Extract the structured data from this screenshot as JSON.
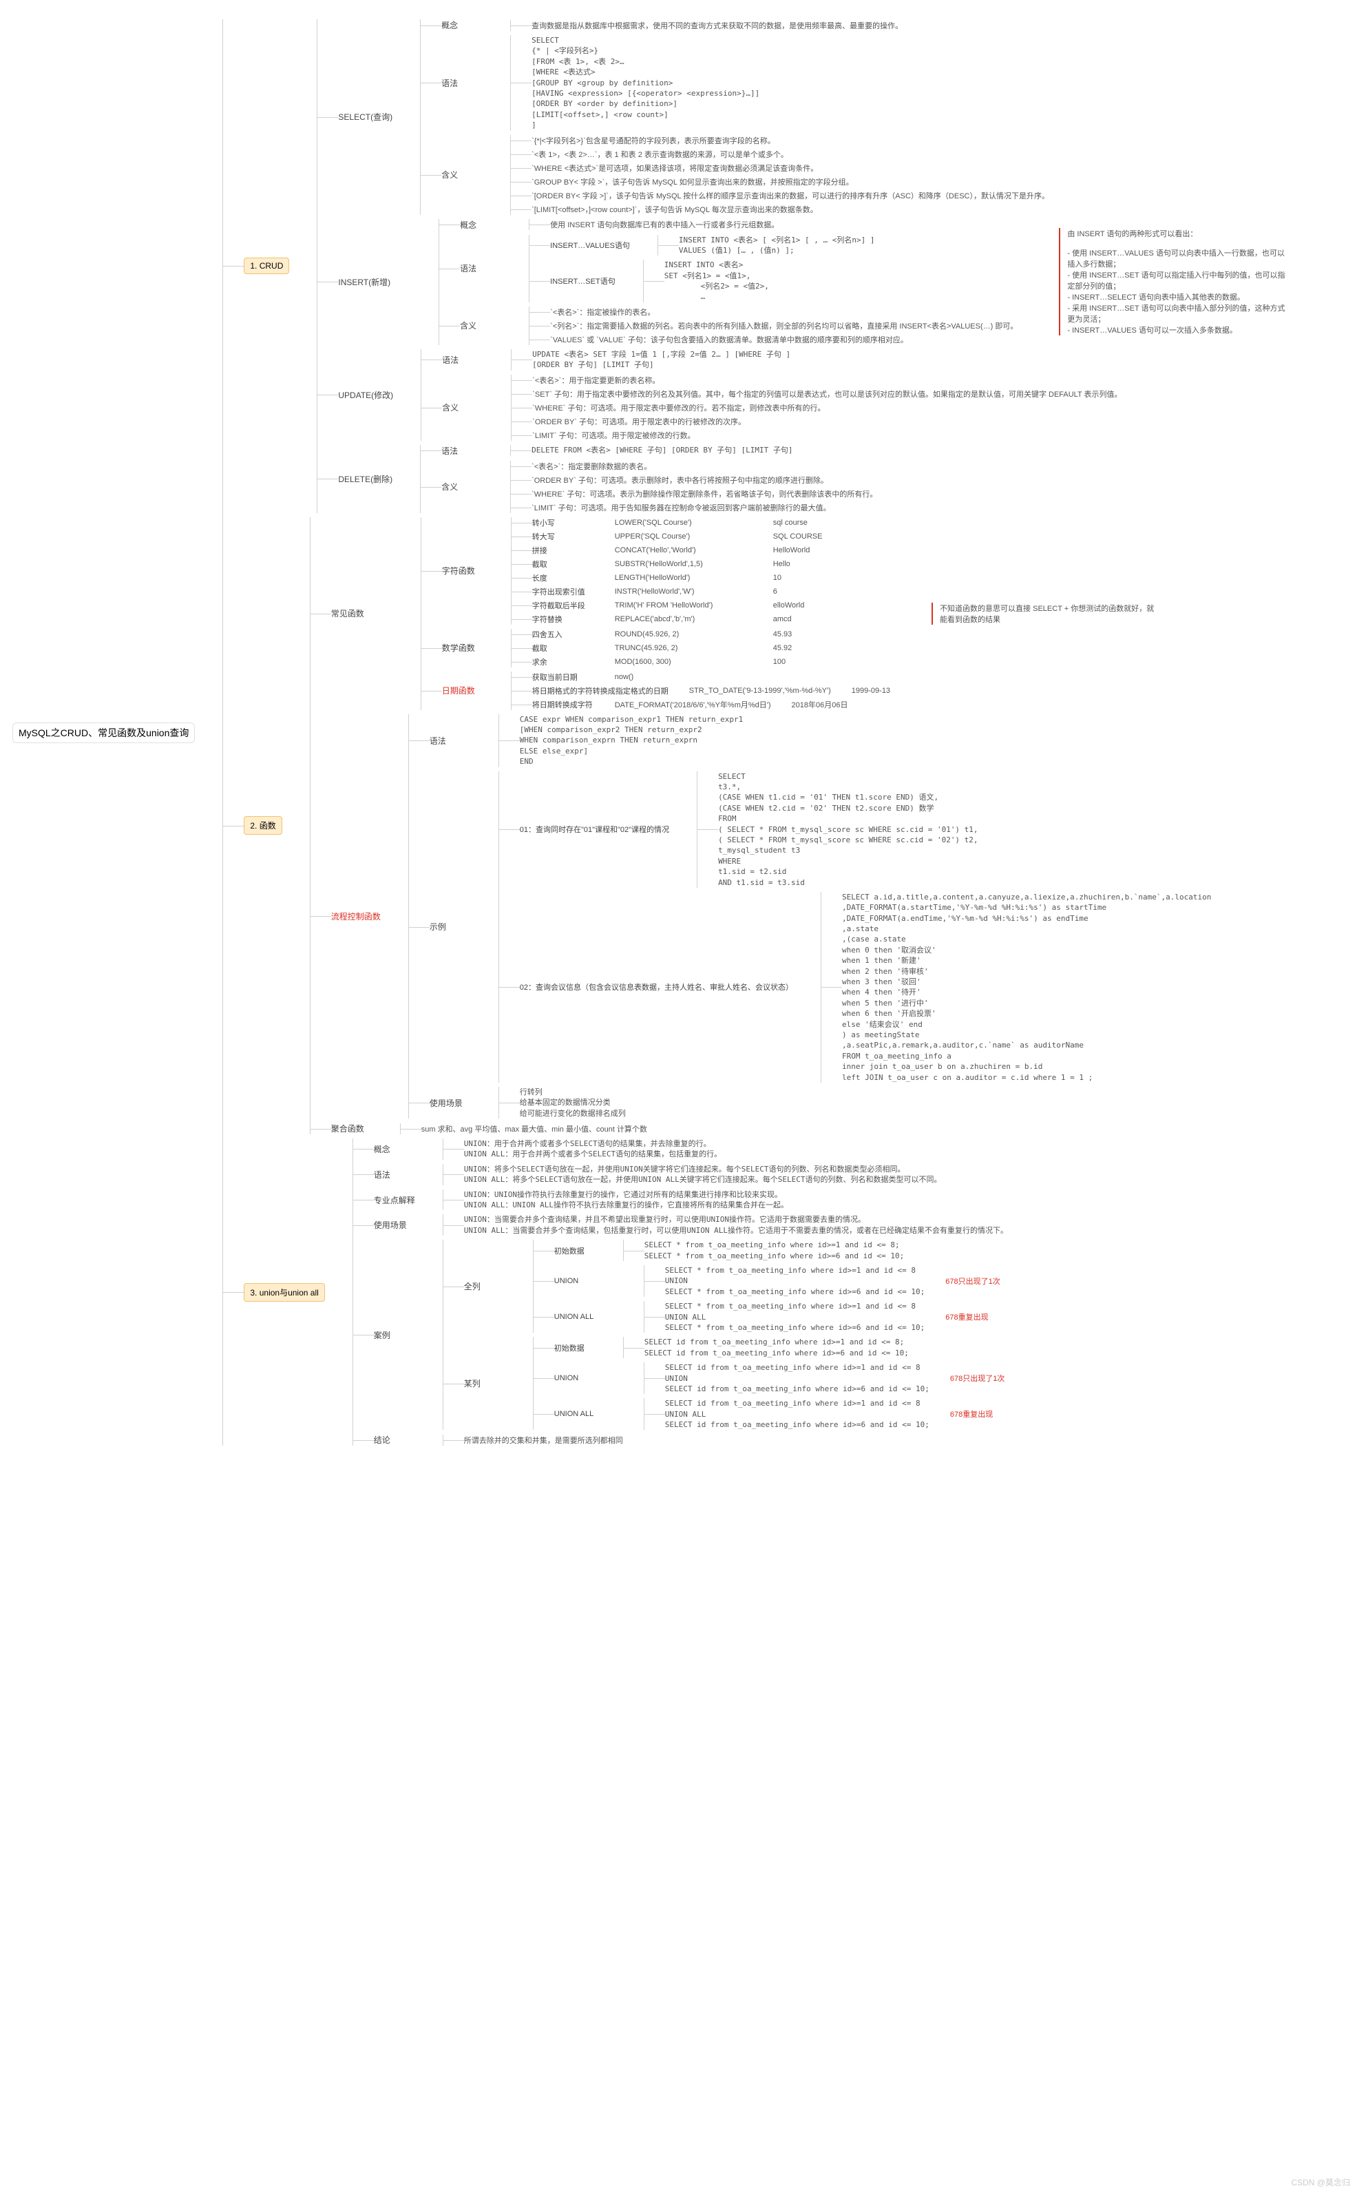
{
  "root": "MySQL之CRUD、常见函数及union查询",
  "watermark": "CSDN @莫念归",
  "l1": [
    "1. CRUD",
    "2. 函数",
    "3. union与union all"
  ],
  "crud": {
    "nodes": [
      "SELECT(查询)",
      "INSERT(新增)",
      "UPDATE(修改)",
      "DELETE(删除)"
    ],
    "select": {
      "concept_lbl": "概念",
      "concept": "查询数据是指从数据库中根据需求，使用不同的查询方式来获取不同的数据，是使用频率最高、最重要的操作。",
      "syntax_lbl": "语法",
      "syntax": "SELECT\n{* | <字段列名>}\n[FROM <表 1>, <表 2>…\n[WHERE <表达式>\n[GROUP BY <group by definition>\n[HAVING <expression> [{<operator> <expression>}…]]\n[ORDER BY <order by definition>]\n[LIMIT[<offset>,] <row count>]\n]",
      "meaning_lbl": "含义",
      "m1": "`{*|<字段列名>}`包含星号通配符的字段列表，表示所要查询字段的名称。",
      "m2": "`<表 1>，<表 2>…`，表 1 和表 2 表示查询数据的来源，可以是单个或多个。",
      "m3": "`WHERE <表达式>`是可选项，如果选择该项，将限定查询数据必须满足该查询条件。",
      "m4": "`GROUP BY< 字段 >`，该子句告诉 MySQL 如何显示查询出来的数据，并按照指定的字段分组。",
      "m5": "`[ORDER BY< 字段 >]`，该子句告诉 MySQL 按什么样的顺序显示查询出来的数据，可以进行的排序有升序（ASC）和降序（DESC），默认情况下是升序。",
      "m6": "`[LIMIT[<offset>，]<row count>]`，该子句告诉 MySQL 每次显示查询出来的数据条数。"
    },
    "insert": {
      "concept_lbl": "概念",
      "concept": "使用 INSERT 语句向数据库已有的表中插入一行或者多行元组数据。",
      "syntax_lbl": "语法",
      "v_lbl": "INSERT…VALUES语句",
      "v_txt": "INSERT INTO <表名> [ <列名1> [ , … <列名n>] ]\nVALUES (值1) [… , (值n) ];",
      "s_lbl": "INSERT…SET语句",
      "s_txt": "INSERT INTO <表名>\nSET <列名1> = <值1>,\n        <列名2> = <值2>,\n        …",
      "meaning_lbl": "含义",
      "m1": "`<表名>`：指定被操作的表名。",
      "m2": "`<列名>`：指定需要插入数据的列名。若向表中的所有列插入数据，则全部的列名均可以省略，直接采用 INSERT<表名>VALUES(…) 即可。",
      "m3": "`VALUES` 或 `VALUE` 子句：该子句包含要插入的数据清单。数据清单中数据的顺序要和列的顺序相对应。",
      "sidenote": "由 INSERT 语句的两种形式可以看出：\n\n- 使用 INSERT…VALUES 语句可以向表中插入一行数据，也可以插入多行数据；\n- 使用 INSERT…SET 语句可以指定插入行中每列的值，也可以指定部分列的值；\n- INSERT…SELECT 语句向表中插入其他表的数据。\n- 采用 INSERT…SET 语句可以向表中插入部分列的值，这种方式更为灵活；\n- INSERT…VALUES 语句可以一次插入多条数据。"
    },
    "update": {
      "syntax_lbl": "语法",
      "syntax": "UPDATE <表名> SET 字段 1=值 1 [,字段 2=值 2… ] [WHERE 子句 ]\n[ORDER BY 子句] [LIMIT 子句]",
      "meaning_lbl": "含义",
      "m1": "`<表名>`：用于指定要更新的表名称。",
      "m2": "`SET` 子句：用于指定表中要修改的列名及其列值。其中，每个指定的列值可以是表达式，也可以是该列对应的默认值。如果指定的是默认值，可用关键字 DEFAULT 表示列值。",
      "m3": "`WHERE` 子句：可选项。用于限定表中要修改的行。若不指定，则修改表中所有的行。",
      "m4": "`ORDER BY` 子句：可选项。用于限定表中的行被修改的次序。",
      "m5": "`LIMIT` 子句：可选项。用于限定被修改的行数。"
    },
    "delete": {
      "syntax_lbl": "语法",
      "syntax": "DELETE FROM <表名> [WHERE 子句] [ORDER BY 子句] [LIMIT 子句]",
      "meaning_lbl": "含义",
      "m1": "`<表名>`：指定要删除数据的表名。",
      "m2": "`ORDER BY` 子句：可选项。表示删除时，表中各行将按照子句中指定的顺序进行删除。",
      "m3": "`WHERE` 子句：可选项。表示为删除操作限定删除条件，若省略该子句，则代表删除该表中的所有行。",
      "m4": "`LIMIT` 子句：可选项。用于告知服务器在控制命令被返回到客户端前被删除行的最大值。"
    }
  },
  "funcs": {
    "common_lbl": "常见函数",
    "string_lbl": "字符函数",
    "num_lbl": "数学函数",
    "date_lbl": "日期函数",
    "sidenote": "不知道函数的意思可以直接 SELECT + 你想测试的函数就好，就能看到函数的结果",
    "string": [
      [
        "转小写",
        "LOWER('SQL Course')",
        "sql course"
      ],
      [
        "转大写",
        "UPPER('SQL Course')",
        "SQL COURSE"
      ],
      [
        "拼接",
        "CONCAT('Hello','World')",
        "HelloWorld"
      ],
      [
        "截取",
        "SUBSTR('HelloWorld',1,5)",
        "Hello"
      ],
      [
        "长度",
        "LENGTH('HelloWorld')",
        "10"
      ],
      [
        "字符出现索引值",
        "INSTR('HelloWorld','W')",
        "6"
      ],
      [
        "字符截取后半段",
        "TRIM('H' FROM 'HelloWorld')",
        "elloWorld"
      ],
      [
        "字符替换",
        "REPLACE('abcd','b','m')",
        "amcd"
      ]
    ],
    "num": [
      [
        "四舍五入",
        "ROUND(45.926, 2)",
        "45.93"
      ],
      [
        "截取",
        "TRUNC(45.926, 2)",
        "45.92"
      ],
      [
        "求余",
        "MOD(1600, 300)",
        "100"
      ]
    ],
    "date": [
      [
        "获取当前日期",
        "now()",
        ""
      ],
      [
        "将日期格式的字符转换成指定格式的日期",
        "STR_TO_DATE('9-13-1999','%m-%d-%Y')",
        "1999-09-13"
      ],
      [
        "将日期转换成字符",
        "DATE_FORMAT('2018/6/6','%Y年%m月%d日')",
        "2018年06月06日"
      ]
    ],
    "flow_lbl": "流程控制函数",
    "flow_syntax_lbl": "语法",
    "flow_syntax": "CASE expr WHEN comparison_expr1 THEN return_expr1\n[WHEN comparison_expr2 THEN return_expr2\nWHEN comparison_exprn THEN return_exprn\nELSE else_expr]\nEND",
    "flow_ex_lbl": "示例",
    "ex01_lbl": "01：查询同时存在\"01\"课程和\"02\"课程的情况",
    "ex01": "SELECT\nt3.*,\n(CASE WHEN t1.cid = '01' THEN t1.score END) 语文,\n(CASE WHEN t2.cid = '02' THEN t2.score END) 数学\nFROM\n( SELECT * FROM t_mysql_score sc WHERE sc.cid = '01') t1,\n( SELECT * FROM t_mysql_score sc WHERE sc.cid = '02') t2,\nt_mysql_student t3\nWHERE\nt1.sid = t2.sid\nAND t1.sid = t3.sid",
    "ex02_lbl": "02：查询会议信息（包含会议信息表数据，主持人姓名、审批人姓名、会议状态）",
    "ex02": "SELECT a.id,a.title,a.content,a.canyuze,a.liexize,a.zhuchiren,b.`name`,a.location\n,DATE_FORMAT(a.startTime,'%Y-%m-%d %H:%i:%s') as startTime\n,DATE_FORMAT(a.endTime,'%Y-%m-%d %H:%i:%s') as endTime\n,a.state\n,(case a.state\nwhen 0 then '取消会议'\nwhen 1 then '新建'\nwhen 2 then '待审核'\nwhen 3 then '驳回'\nwhen 4 then '待开'\nwhen 5 then '进行中'\nwhen 6 then '开启投票'\nelse '结束会议' end\n) as meetingState\n,a.seatPic,a.remark,a.auditor,c.`name` as auditorName\nFROM t_oa_meeting_info a\ninner join t_oa_user b on a.zhuchiren = b.id\nleft JOIN t_oa_user c on a.auditor = c.id where 1 = 1 ;",
    "scene_lbl": "使用场景",
    "scene": "行转列\n给基本固定的数据情况分类\n给可能进行变化的数据排名成列",
    "agg_lbl": "聚合函数",
    "agg": "sum 求和、avg 平均值、max 最大值、min 最小值、count 计算个数"
  },
  "union": {
    "concept_lbl": "概念",
    "concept": "UNION：用于合并两个或者多个SELECT语句的结果集，并去除重复的行。\nUNION ALL：用于合并两个或者多个SELECT语句的结果集，包括重复的行。",
    "syntax_lbl": "语法",
    "syntax": "UNION：将多个SELECT语句放在一起，并使用UNION关键字将它们连接起来。每个SELECT语句的列数、列名和数据类型必须相同。\nUNION ALL：将多个SELECT语句放在一起，并使用UNION ALL关键字将它们连接起来。每个SELECT语句的列数、列名和数据类型可以不同。",
    "pro_lbl": "专业点解释",
    "pro": "UNION：UNION操作符执行去除重复行的操作，它通过对所有的结果集进行排序和比较来实现。\nUNION ALL：UNION ALL操作符不执行去除重复行的操作，它直接将所有的结果集合并在一起。",
    "scene_lbl": "使用场景",
    "scene": "UNION：当需要合并多个查询结果，并且不希望出现重复行时，可以使用UNION操作符。它适用于数据需要去重的情况。\nUNION ALL：当需要合并多个查询结果，包括重复行时，可以使用UNION ALL操作符。它适用于不需要去重的情况，或者在已经确定结果不会有重复行的情况下。",
    "ex_lbl": "案例",
    "all_lbl": "全列",
    "row_lbl": "某列",
    "init_lbl": "初始数据",
    "u_lbl": "UNION",
    "ua_lbl": "UNION ALL",
    "all_init": "SELECT * from t_oa_meeting_info where id>=1 and id <= 8;\nSELECT * from t_oa_meeting_info where id>=6 and id <= 10;",
    "all_union": "SELECT * from t_oa_meeting_info where id>=1 and id <= 8\nUNION\nSELECT * from t_oa_meeting_info where id>=6 and id <= 10;",
    "all_union_note": "678只出现了1次",
    "all_ua": "SELECT * from t_oa_meeting_info where id>=1 and id <= 8\nUNION ALL\nSELECT * from t_oa_meeting_info where id>=6 and id <= 10;",
    "all_ua_note": "678重复出现",
    "row_init": "SELECT id from t_oa_meeting_info where id>=1 and id <= 8;\nSELECT id from t_oa_meeting_info where id>=6 and id <= 10;",
    "row_union": "SELECT id from t_oa_meeting_info where id>=1 and id <= 8\nUNION\nSELECT id from t_oa_meeting_info where id>=6 and id <= 10;",
    "row_union_note": "678只出现了1次",
    "row_ua": "SELECT id from t_oa_meeting_info where id>=1 and id <= 8\nUNION ALL\nSELECT id from t_oa_meeting_info where id>=6 and id <= 10;",
    "row_ua_note": "678重复出现",
    "end_lbl": "结论",
    "end": "所谓去除并的交集和并集，是需要所选列都相同"
  }
}
